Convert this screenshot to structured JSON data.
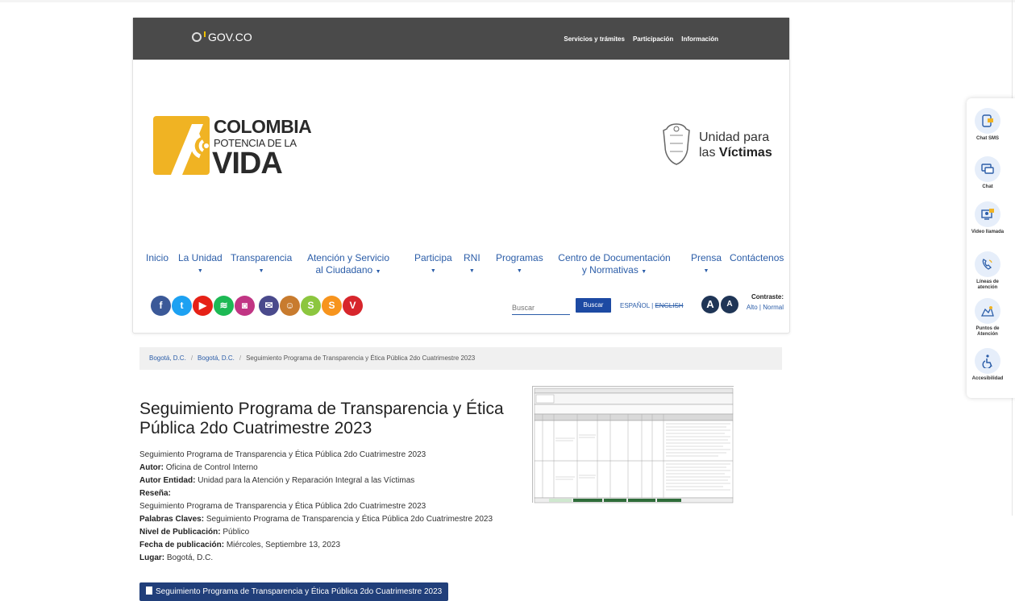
{
  "gov_bar": {
    "logo_text": "GOV.CO",
    "links": [
      "Servicios y trámites",
      "Participación",
      "Información"
    ]
  },
  "brand": {
    "line1": "COLOMBIA",
    "line2": "POTENCIA DE LA",
    "line3": "VIDA"
  },
  "entity_logo": {
    "line1": "Unidad para",
    "line2_prefix": "las ",
    "line2_bold": "Víctimas"
  },
  "nav": {
    "items": [
      {
        "label": "Inicio",
        "dropdown": false
      },
      {
        "label": "La Unidad",
        "dropdown": true
      },
      {
        "label": "Transparencia",
        "dropdown": true
      },
      {
        "label": "Atención y Servicio al Ciudadano",
        "dropdown": true
      },
      {
        "label": "Participa",
        "dropdown": true
      },
      {
        "label": "RNI",
        "dropdown": true
      },
      {
        "label": "Programas",
        "dropdown": true
      },
      {
        "label": "Centro de Documentación y Normativas",
        "dropdown": true
      },
      {
        "label": "Prensa",
        "dropdown": true
      },
      {
        "label": "Contáctenos",
        "dropdown": false
      }
    ]
  },
  "social": [
    {
      "icon": "facebook-icon",
      "glyph": "f",
      "color": "#3b5998"
    },
    {
      "icon": "twitter-icon",
      "glyph": "t",
      "color": "#1da1f2"
    },
    {
      "icon": "youtube-icon",
      "glyph": "▶",
      "color": "#e62117"
    },
    {
      "icon": "spotify-icon",
      "glyph": "≋",
      "color": "#1db954"
    },
    {
      "icon": "instagram-icon",
      "glyph": "◙",
      "color": "#c13584"
    },
    {
      "icon": "email-icon",
      "glyph": "✉",
      "color": "#4a4a8c"
    },
    {
      "icon": "mascot-icon",
      "glyph": "☺",
      "color": "#c87b2e"
    },
    {
      "icon": "s-green-icon",
      "glyph": "S",
      "color": "#8cc63f"
    },
    {
      "icon": "s-orange-icon",
      "glyph": "S",
      "color": "#f7941d"
    },
    {
      "icon": "v-red-icon",
      "glyph": "V",
      "color": "#d7262c"
    }
  ],
  "search": {
    "placeholder": "Buscar",
    "button": "Buscar"
  },
  "language": {
    "es": "ESPAÑOL",
    "sep": "|",
    "en": "ENGLISH"
  },
  "accessibility": {
    "font_up": "A",
    "font_down": "A",
    "contrast_label": "Contraste:",
    "contrast_high": "Alto",
    "contrast_sep": "|",
    "contrast_normal": "Normal"
  },
  "breadcrumb": [
    "Bogotá, D.C.",
    "Bogotá, D.C.",
    "Seguimiento Programa de Transparencia y Ética Pública 2do Cuatrimestre 2023"
  ],
  "article": {
    "title": "Seguimiento Programa de Transparencia y Ética Pública 2do Cuatrimestre 2023",
    "subtitle": "Seguimiento Programa de Transparencia y Ética Pública 2do Cuatrimestre 2023",
    "autor_label": "Autor:",
    "autor": "Oficina de Control Interno",
    "autor_entidad_label": "Autor Entidad:",
    "autor_entidad": "Unidad para la Atención y Reparación Integral a las Víctimas",
    "resena_label": "Reseña:",
    "resena": "Seguimiento Programa de Transparencia y Ética Pública 2do Cuatrimestre 2023",
    "palabras_label": "Palabras Claves:",
    "palabras": "Seguimiento Programa de Transparencia y Ética Pública 2do Cuatrimestre 2023",
    "nivel_label": "Nivel de Publicación:",
    "nivel": "Público",
    "fecha_label": "Fecha de publicación:",
    "fecha": "Miércoles, Septiembre 13, 2023",
    "lugar_label": "Lugar:",
    "lugar": "Bogotá, D.C.",
    "download_button": "Seguimiento Programa de Transparencia y Ética Pública 2do Cuatrimestre 2023"
  },
  "sidebar": [
    {
      "icon": "chat-sms-icon",
      "label": "Chat SMS"
    },
    {
      "icon": "chat-icon",
      "label": "Chat"
    },
    {
      "icon": "video-call-icon",
      "label": "Video llamada"
    },
    {
      "icon": "phone-lines-icon",
      "label": "Líneas de atención"
    },
    {
      "icon": "map-points-icon",
      "label": "Puntos de Atención"
    },
    {
      "icon": "accessibility-icon",
      "label": "Accesibilidad"
    }
  ]
}
